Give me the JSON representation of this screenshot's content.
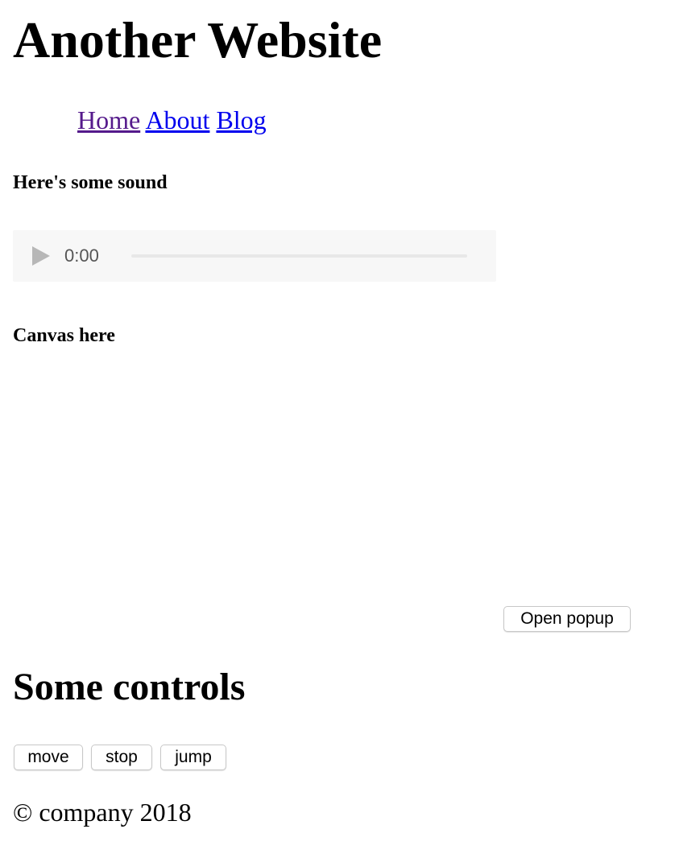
{
  "header": {
    "title": "Another Website"
  },
  "nav": {
    "items": [
      {
        "label": "Home"
      },
      {
        "label": "About"
      },
      {
        "label": "Blog"
      }
    ]
  },
  "sound_section": {
    "label": "Here's some sound",
    "audio": {
      "time": "0:00",
      "play_icon": "play-icon"
    }
  },
  "canvas_section": {
    "label": "Canvas here"
  },
  "popup": {
    "button_label": "Open popup"
  },
  "controls": {
    "title": "Some controls",
    "buttons": [
      {
        "label": "move"
      },
      {
        "label": "stop"
      },
      {
        "label": "jump"
      }
    ]
  },
  "footer": {
    "text": "© company 2018"
  },
  "colors": {
    "link": "#0000ee",
    "visited_link": "#551a8b",
    "audio_background": "#f7f7f7"
  }
}
